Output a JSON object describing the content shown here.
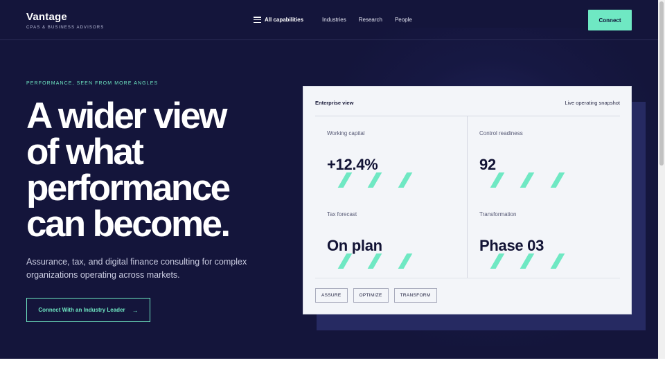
{
  "header": {
    "brand_name": "Vantage",
    "brand_tagline": "CPAS & BUSINESS ADVISORS",
    "nav": [
      {
        "label": "All capabilities"
      },
      {
        "label": "Industries"
      },
      {
        "label": "Research"
      },
      {
        "label": "People"
      }
    ],
    "connect_label": "Connect"
  },
  "hero": {
    "eyebrow": "PERFORMANCE, SEEN FROM MORE ANGLES",
    "headline_lines": [
      "A wider view",
      "of what",
      "performance",
      "can become."
    ],
    "subcopy": "Assurance, tax, and digital finance consulting for complex organizations operating across markets.",
    "cta_label": "Connect With an Industry Leader",
    "cta_arrow": "→"
  },
  "panel": {
    "title": "Enterprise view",
    "meta": "Live operating snapshot",
    "metrics": [
      {
        "label": "Working capital",
        "value": "+12.4%"
      },
      {
        "label": "Control readiness",
        "value": "92"
      },
      {
        "label": "Tax forecast",
        "value": "On plan"
      },
      {
        "label": "Transformation",
        "value": "Phase 03"
      }
    ],
    "chips": [
      "ASSURE",
      "OPTIMIZE",
      "TRANSFORM"
    ]
  },
  "colors": {
    "background": "#14153b",
    "accent": "#6fe8c3",
    "panel": "#f3f5f9"
  },
  "icons": [
    "menu-icon",
    "arrow-right-icon"
  ]
}
